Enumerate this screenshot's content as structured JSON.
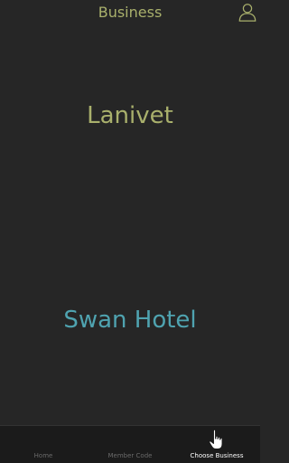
{
  "header": {
    "title": "Business",
    "profile_icon": "user-outline-icon"
  },
  "businesses": [
    {
      "name": "Lanivet",
      "color": "#a9b06c"
    },
    {
      "name": "Swan Hotel",
      "color": "#4fa3b0"
    }
  ],
  "tabbar": {
    "tabs": [
      {
        "label": "Home",
        "active": false
      },
      {
        "label": "Member Code",
        "active": false
      },
      {
        "label": "Choose Business",
        "active": true,
        "icon": "pointing-hand-icon"
      }
    ],
    "active_color": "#ffffff",
    "inactive_color": "#6a6a6a"
  }
}
